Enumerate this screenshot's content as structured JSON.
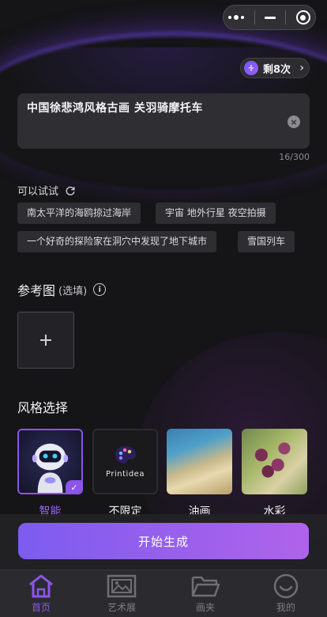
{
  "credits": {
    "label": "剩8次"
  },
  "prompt": {
    "text": "中国徐悲鸿风格古画 关羽骑摩托车",
    "counter": "16/300"
  },
  "suggestions": {
    "title": "可以试试",
    "items": [
      "南太平洋的海鸥掠过海岸",
      "宇宙 地外行星 夜空拍摄",
      "一个好奇的探险家在洞穴中发现了地下城市",
      "雪国列车"
    ]
  },
  "reference": {
    "title": "参考图",
    "optional": "(选填)"
  },
  "styles": {
    "title": "风格选择",
    "items": [
      {
        "label": "智能",
        "selected": true
      },
      {
        "label": "不限定",
        "selected": false,
        "logo_text": "Printidea"
      },
      {
        "label": "油画",
        "selected": false
      },
      {
        "label": "水彩",
        "selected": false
      }
    ]
  },
  "start_button": {
    "label": "开始生成"
  },
  "tabs": [
    {
      "label": "首页",
      "icon": "home-icon",
      "active": true
    },
    {
      "label": "艺术展",
      "icon": "gallery-icon",
      "active": false
    },
    {
      "label": "画夹",
      "icon": "folder-icon",
      "active": false
    },
    {
      "label": "我的",
      "icon": "smile-icon",
      "active": false
    }
  ],
  "colors": {
    "accent": "#8c55ee",
    "background": "#151517",
    "button_gradient_start": "#7c5cf0",
    "button_gradient_end": "#b063ea"
  }
}
